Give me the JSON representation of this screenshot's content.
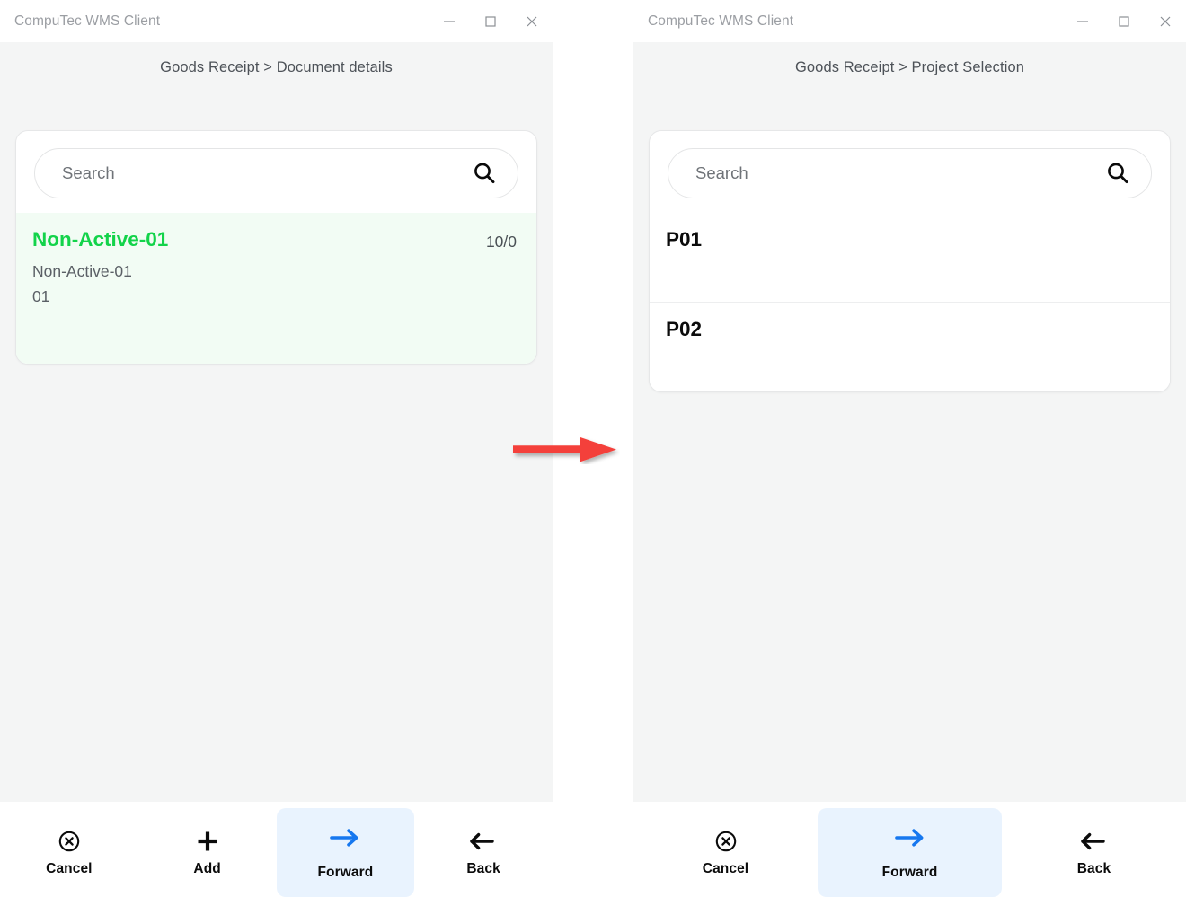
{
  "panels": [
    {
      "id": "left",
      "window_title": "CompuTec WMS Client",
      "breadcrumb": "Goods Receipt > Document details",
      "window_controls": [
        {
          "name": "minimize-button",
          "glyph": "minimize"
        },
        {
          "name": "maximize-button",
          "glyph": "maximize"
        },
        {
          "name": "close-button",
          "glyph": "close"
        }
      ],
      "search": {
        "value": "",
        "placeholder": "Search",
        "icon": "search-icon"
      },
      "list": [
        {
          "title": "Non-Active-01",
          "count": "10/0",
          "sub1": "Non-Active-01",
          "sub2": "01",
          "selected": true
        }
      ],
      "toolbar": [
        {
          "label": "Cancel",
          "icon": "cancel-circle-icon",
          "active": false
        },
        {
          "label": "Add",
          "icon": "plus-icon",
          "active": false
        },
        {
          "label": "Forward",
          "icon": "arrow-right-icon",
          "active": true
        },
        {
          "label": "Back",
          "icon": "arrow-left-icon",
          "active": false
        }
      ]
    },
    {
      "id": "right",
      "window_title": "CompuTec WMS Client",
      "breadcrumb": "Goods Receipt > Project Selection",
      "window_controls": [
        {
          "name": "minimize-button",
          "glyph": "minimize"
        },
        {
          "name": "maximize-button",
          "glyph": "maximize"
        },
        {
          "name": "close-button",
          "glyph": "close"
        }
      ],
      "search": {
        "value": "",
        "placeholder": "Search",
        "icon": "search-icon"
      },
      "list": [
        {
          "title": "P01",
          "count": "",
          "sub1": "",
          "sub2": "",
          "selected": false
        },
        {
          "title": "P02",
          "count": "",
          "sub1": "",
          "sub2": "",
          "selected": false
        }
      ],
      "toolbar": [
        {
          "label": "Cancel",
          "icon": "cancel-circle-icon",
          "active": false
        },
        {
          "label": "Forward",
          "icon": "arrow-right-icon",
          "active": true
        },
        {
          "label": "Back",
          "icon": "arrow-left-icon",
          "active": false
        }
      ]
    }
  ],
  "annotation": {
    "type": "arrow",
    "direction": "right",
    "color": "#f4403a"
  },
  "colors": {
    "content_background": "#f4f5f5",
    "card_background": "#ffffff",
    "selected_row_background": "#f2fcf4",
    "selected_title": "#13d34a",
    "active_toolbar_background": "#e9f3fe",
    "active_toolbar_icon": "#1677ef",
    "titlebar_text": "#9b9ea3",
    "breadcrumb_text": "#4d5258"
  }
}
